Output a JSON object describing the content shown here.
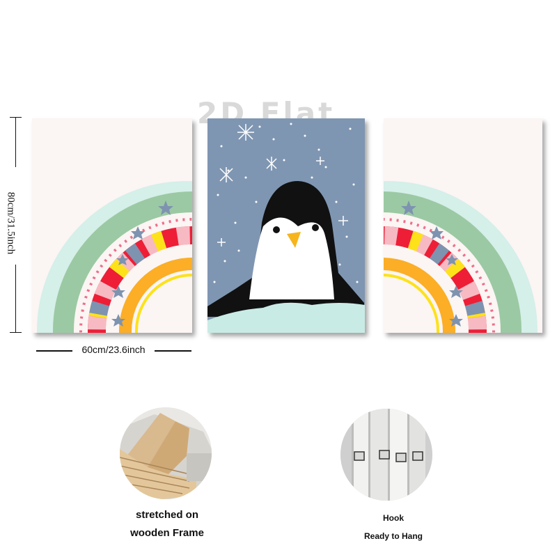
{
  "watermark": "2D Flat",
  "dimensions": {
    "height_label": "80cm/31.5inch",
    "width_label": "60cm/23.6inch"
  },
  "features": [
    {
      "lines": [
        "stretched on",
        "wooden Frame"
      ]
    },
    {
      "lines": [
        "Hook",
        "Ready to Hang"
      ]
    }
  ],
  "colors": {
    "rainbow_green": "#9bc9a3",
    "rainbow_mint": "#d5efe9",
    "rainbow_red": "#ee1e37",
    "rainbow_pink": "#f7bac3",
    "rainbow_yellow": "#fde21a",
    "rainbow_orange": "#fbae26",
    "rainbow_blue": "#7d93b0",
    "sky_blue": "#7f96b2",
    "snow": "#c9ebe5",
    "penguin_black": "#111111",
    "beak": "#f6b51c"
  }
}
